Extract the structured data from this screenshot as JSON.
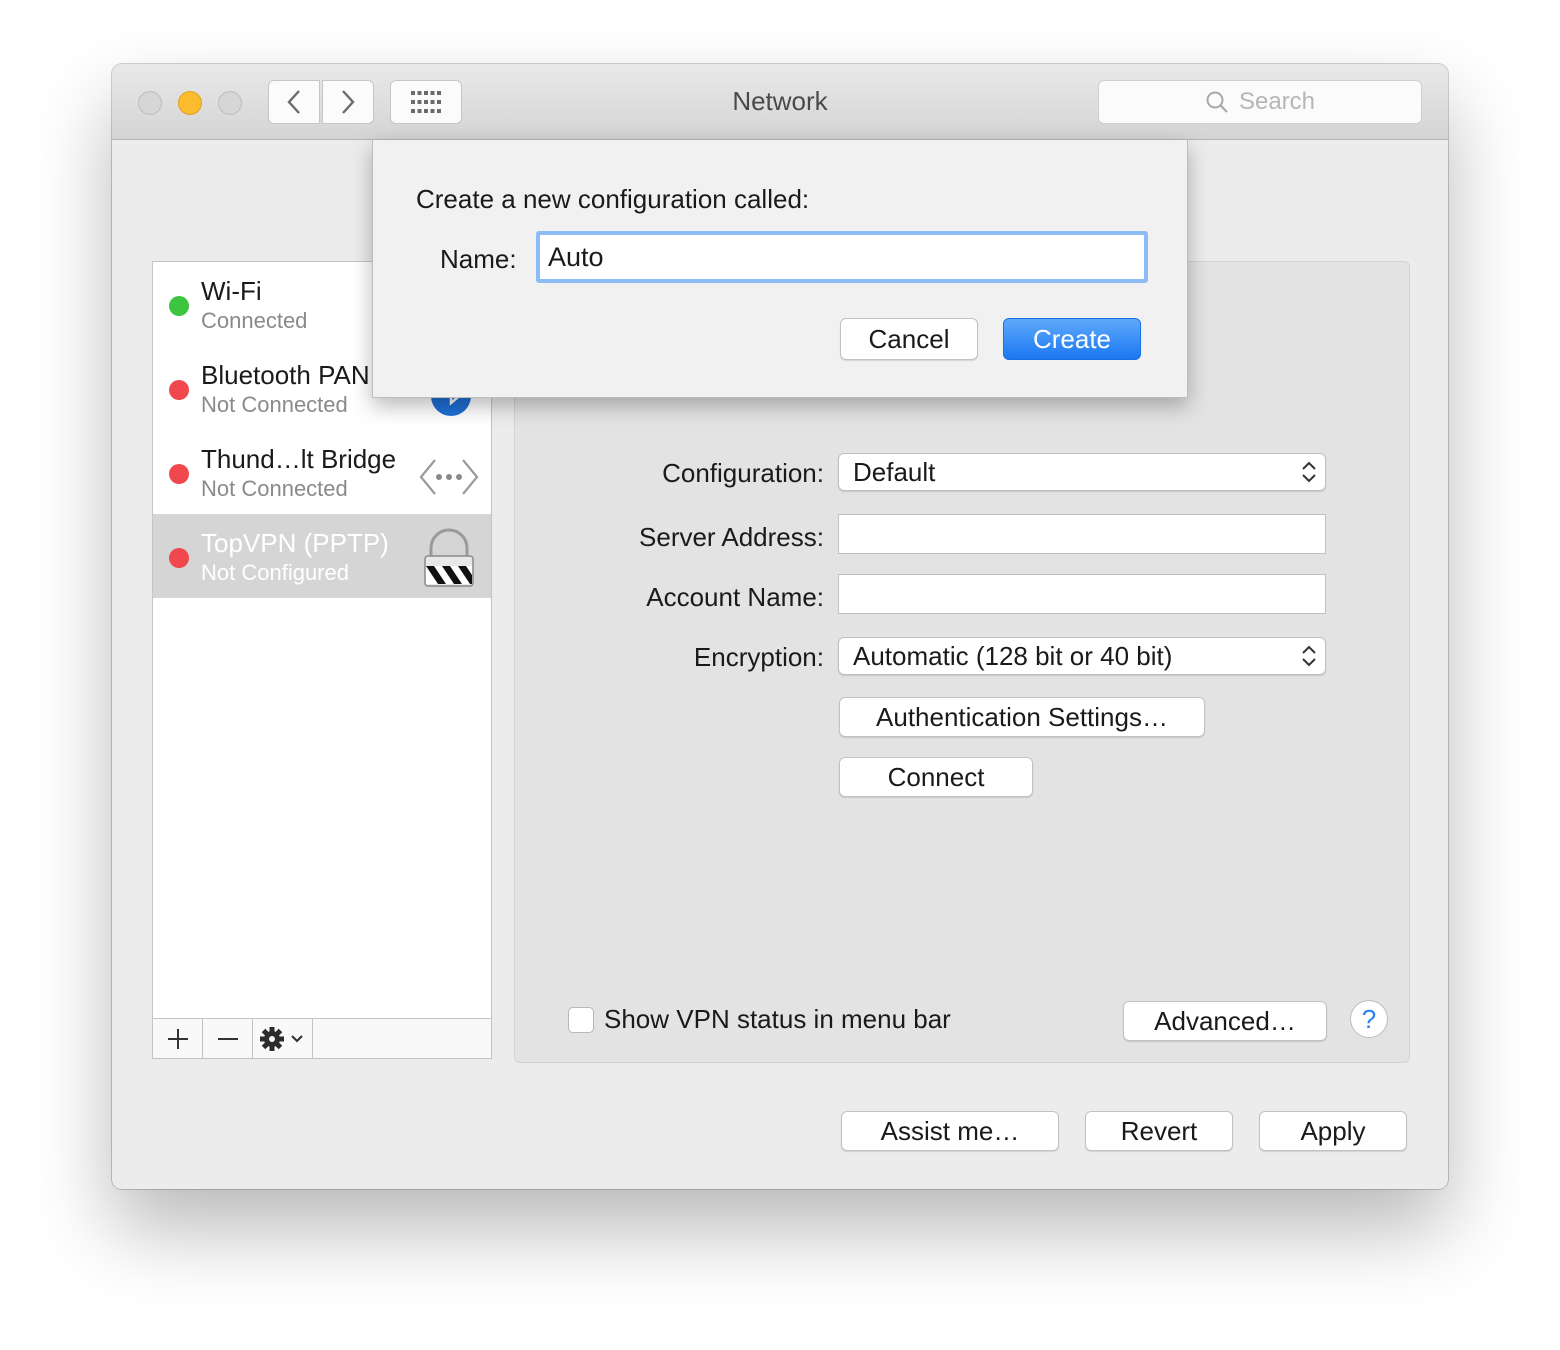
{
  "window": {
    "title": "Network"
  },
  "search": {
    "placeholder": "Search"
  },
  "services": [
    {
      "name": "Wi-Fi",
      "status": "Connected",
      "status_color": "#3dc540"
    },
    {
      "name": "Bluetooth PAN",
      "status": "Not Connected",
      "status_color": "#f0484d",
      "icon": "bluetooth-icon"
    },
    {
      "name": "Thund…lt Bridge",
      "status": "Not Connected",
      "status_color": "#f0484d",
      "icon": "thunderbolt-bridge-icon"
    },
    {
      "name": "TopVPN (PPTP)",
      "status": "Not Configured",
      "status_color": "#f0484d",
      "icon": "vpn-lock-icon",
      "selected": true
    }
  ],
  "sidebar_toolbar": {
    "add": "+",
    "remove": "—",
    "action": "gear-icon"
  },
  "form": {
    "configuration_label": "Configuration:",
    "configuration_value": "Default",
    "server_label": "Server Address:",
    "server_value": "",
    "account_label": "Account Name:",
    "account_value": "",
    "encryption_label": "Encryption:",
    "encryption_value": "Automatic (128 bit or 40 bit)",
    "auth_button": "Authentication Settings…",
    "connect_button": "Connect"
  },
  "panel_bottom": {
    "show_status_label": "Show VPN status in menu bar",
    "show_status_checked": false,
    "advanced_button": "Advanced…",
    "help_button": "?"
  },
  "footer": {
    "assist_button": "Assist me…",
    "revert_button": "Revert",
    "apply_button": "Apply"
  },
  "sheet": {
    "prompt": "Create a new configuration called:",
    "name_label": "Name:",
    "name_value": "Auto",
    "cancel_button": "Cancel",
    "create_button": "Create"
  },
  "colors": {
    "accent": "#1b78f2",
    "focus_ring": "#8dbcf5",
    "selection": "#d5d5d5"
  }
}
